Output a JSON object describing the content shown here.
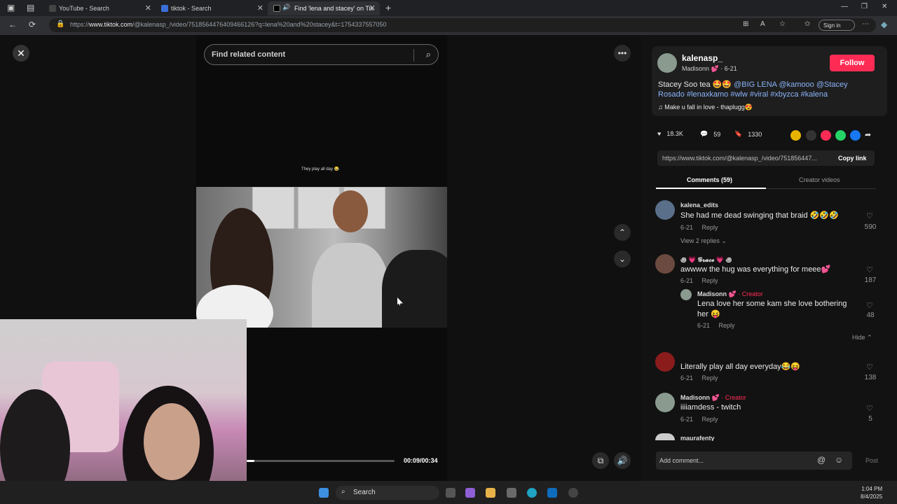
{
  "browser": {
    "tabs": [
      {
        "title": "YouTube - Search"
      },
      {
        "title": "tiktok - Search"
      },
      {
        "title": "Find 'lena and stacey' on Tik"
      }
    ],
    "url_prefix": "https://",
    "url_host": "www.tiktok.com",
    "url_path": "/@kalenasp_/video/7518564476409466126?q=lena%20and%20stacey&t=1754337557050",
    "sign_in_label": "Sign in"
  },
  "video": {
    "search_placeholder": "Find related content",
    "caption": "They play all day 😂",
    "progress_fraction": 0.05,
    "time": "00:09/00:34"
  },
  "post": {
    "username": "kalenasp_",
    "display_name": "Madisonn",
    "heart_emoji": "💕",
    "date": " · 6-21",
    "follow_label": "Follow",
    "desc_text": "Stacey Soo tea 🤩🤩 ",
    "desc_tags": "@BIG LENA @kamooo @Stacey Rosado #lenaxkamo #wlw #viral #xbyzca #kalena",
    "music": "♫   Make u fall in love - thaplugg😍",
    "likes": "18.3K",
    "comments_count": "59",
    "saves": "1330",
    "link": "https://www.tiktok.com/@kalenasp_/video/751856447...",
    "copy_label": "Copy link",
    "tab_comments": "Comments (59)",
    "tab_creator": "Creator videos"
  },
  "comments": [
    {
      "user": "kalena_edits",
      "text": "She had me dead swinging that braid 🤣🤣🤣",
      "date": "6-21",
      "reply": "Reply",
      "likes": "590",
      "more": "View 2 replies ⌄"
    },
    {
      "user": "꩜ 💗 𝓖𝓻𝓪𝓬𝓮 💗 ꩜",
      "text": "awwww the hug was everything for meee💕",
      "date": "6-21",
      "reply": "Reply",
      "likes": "187"
    },
    {
      "user": "Madisonn 💕",
      "creator": " · Creator",
      "text": "Lena love her some kam she love bothering",
      "text2": "her 😝",
      "date": "6-21",
      "reply": "Reply",
      "likes": "48",
      "hide": "Hide ⌃"
    },
    {
      "user": "",
      "text": "Literally play all day everyday😂😝",
      "date": "6-21",
      "reply": "Reply",
      "likes": "138"
    },
    {
      "user": "Madisonn 💕",
      "creator": " · Creator",
      "text": "iiiiamdess - twitch",
      "date": "6-21",
      "reply": "Reply",
      "likes": "5"
    },
    {
      "user": "maurafenty"
    }
  ],
  "comment_box": {
    "placeholder": "Add comment...",
    "post": "Post"
  },
  "taskbar": {
    "search": "Search",
    "time": "1:04 PM",
    "date": "8/4/2025"
  }
}
